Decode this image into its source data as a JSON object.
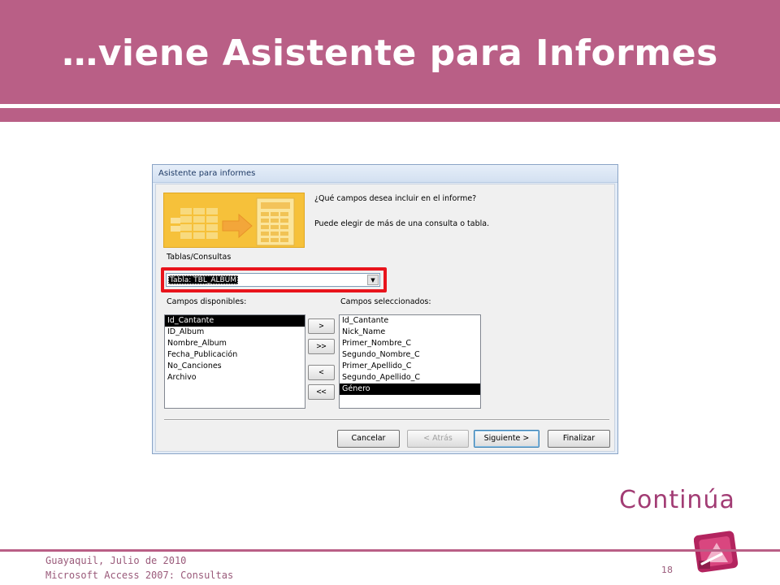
{
  "slide": {
    "title": "…viene Asistente para Informes",
    "continua": "Continúa",
    "footer_line1": "Guayaquil, Julio de 2010",
    "footer_line2": "Microsoft Access 2007: Consultas",
    "page_number": "18",
    "colors": {
      "band": "#b95f86",
      "accent_text": "#a23c74",
      "highlight": "#e8141c"
    }
  },
  "dialog": {
    "title": "Asistente para informes",
    "question": "¿Qué campos desea incluir en el informe?",
    "hint": "Puede elegir de más de una consulta o tabla.",
    "tables_label": "Tablas/Consultas",
    "table_selected": "Tabla: TBL_ALBUM",
    "available_label": "Campos disponibles:",
    "selected_label": "Campos seleccionados:",
    "available_fields": [
      "Id_Cantante",
      "ID_Album",
      "Nombre_Album",
      "Fecha_Publicación",
      "No_Canciones",
      "Archivo"
    ],
    "available_selected_item": "Id_Cantante",
    "selected_fields": [
      "Id_Cantante",
      "Nick_Name",
      "Primer_Nombre_C",
      "Segundo_Nombre_C",
      "Primer_Apellido_C",
      "Segundo_Apellido_C",
      "Género"
    ],
    "selected_selected_item": "Género",
    "move_buttons": {
      "add_one": ">",
      "add_all": ">>",
      "remove_one": "<",
      "remove_all": "<<"
    },
    "buttons": {
      "cancel": "Cancelar",
      "back": "< Atrás",
      "next": "Siguiente >",
      "finish": "Finalizar"
    },
    "back_enabled": false
  }
}
